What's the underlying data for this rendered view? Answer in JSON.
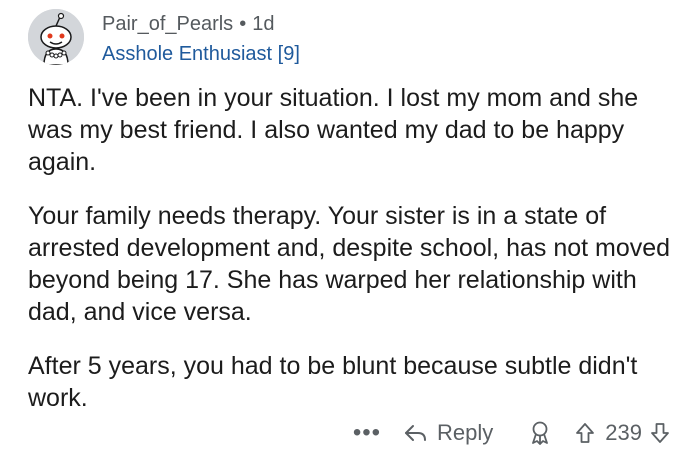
{
  "comment": {
    "username": "Pair_of_Pearls",
    "separator": "•",
    "timestamp": "1d",
    "flair": "Asshole Enthusiast [9]",
    "paragraphs": [
      "NTA. I've been in your situation. I lost my mom and she was my best friend.  I also wanted my dad to be happy again.",
      "Your family needs therapy. Your sister is in a state of arrested development and, despite school, has not moved beyond being 17. She has warped her relationship with dad, and vice versa.",
      "After 5 years, you had to be blunt because subtle didn't work."
    ]
  },
  "actions": {
    "more": "•••",
    "reply": "Reply",
    "score": "239"
  },
  "icons": {
    "avatar": "snoo-avatar",
    "reply": "reply-arrow-icon",
    "award": "award-icon",
    "upvote": "upvote-arrow-icon",
    "downvote": "downvote-arrow-icon"
  }
}
